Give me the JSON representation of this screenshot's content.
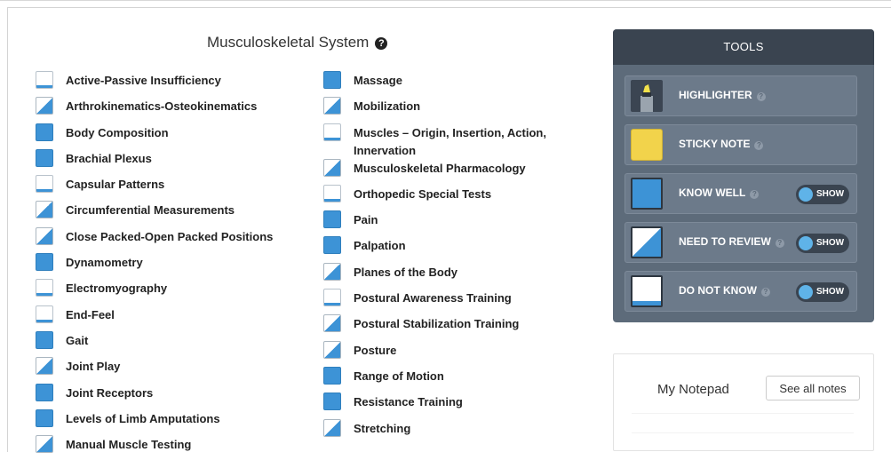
{
  "title": "Musculoskeletal System",
  "column1": [
    {
      "label": "Active-Passive Insufficiency",
      "status": "notknow"
    },
    {
      "label": "Arthrokinematics-Osteokinematics",
      "status": "review"
    },
    {
      "label": "Body Composition",
      "status": "know"
    },
    {
      "label": "Brachial Plexus",
      "status": "know"
    },
    {
      "label": "Capsular Patterns",
      "status": "notknow"
    },
    {
      "label": "Circumferential Measurements",
      "status": "review"
    },
    {
      "label": "Close Packed-Open Packed Positions",
      "status": "review"
    },
    {
      "label": "Dynamometry",
      "status": "know"
    },
    {
      "label": "Electromyography",
      "status": "notknow"
    },
    {
      "label": "End-Feel",
      "status": "notknow"
    },
    {
      "label": "Gait",
      "status": "know"
    },
    {
      "label": "Joint Play",
      "status": "review"
    },
    {
      "label": "Joint Receptors",
      "status": "know"
    },
    {
      "label": "Levels of Limb Amputations",
      "status": "know"
    },
    {
      "label": "Manual Muscle Testing",
      "status": "review"
    }
  ],
  "column2": [
    {
      "label": "Massage",
      "status": "know"
    },
    {
      "label": "Mobilization",
      "status": "review"
    },
    {
      "label": "Muscles – Origin, Insertion, Action, Innervation",
      "status": "notknow"
    },
    {
      "label": "Musculoskeletal Pharmacology",
      "status": "review"
    },
    {
      "label": "Orthopedic Special Tests",
      "status": "notknow"
    },
    {
      "label": "Pain",
      "status": "know"
    },
    {
      "label": "Palpation",
      "status": "know"
    },
    {
      "label": "Planes of the Body",
      "status": "review"
    },
    {
      "label": "Postural Awareness Training",
      "status": "notknow"
    },
    {
      "label": "Postural Stabilization Training",
      "status": "review"
    },
    {
      "label": "Posture",
      "status": "review"
    },
    {
      "label": "Range of Motion",
      "status": "know"
    },
    {
      "label": "Resistance Training",
      "status": "know"
    },
    {
      "label": "Stretching",
      "status": "review"
    }
  ],
  "tools": {
    "header": "TOOLS",
    "highlighter": "HIGHLIGHTER",
    "sticky_note": "STICKY NOTE",
    "know_well": "KNOW WELL",
    "need_to_review": "NEED TO REVIEW",
    "do_not_know": "DO NOT KNOW",
    "show_label": "SHOW"
  },
  "notepad": {
    "title": "My Notepad",
    "see_all": "See all notes"
  },
  "colors": {
    "accent_blue": "#3d93d6",
    "tools_bg": "#5d6b7a",
    "tools_header": "#3a4450",
    "sticky_yellow": "#f2d34b"
  }
}
